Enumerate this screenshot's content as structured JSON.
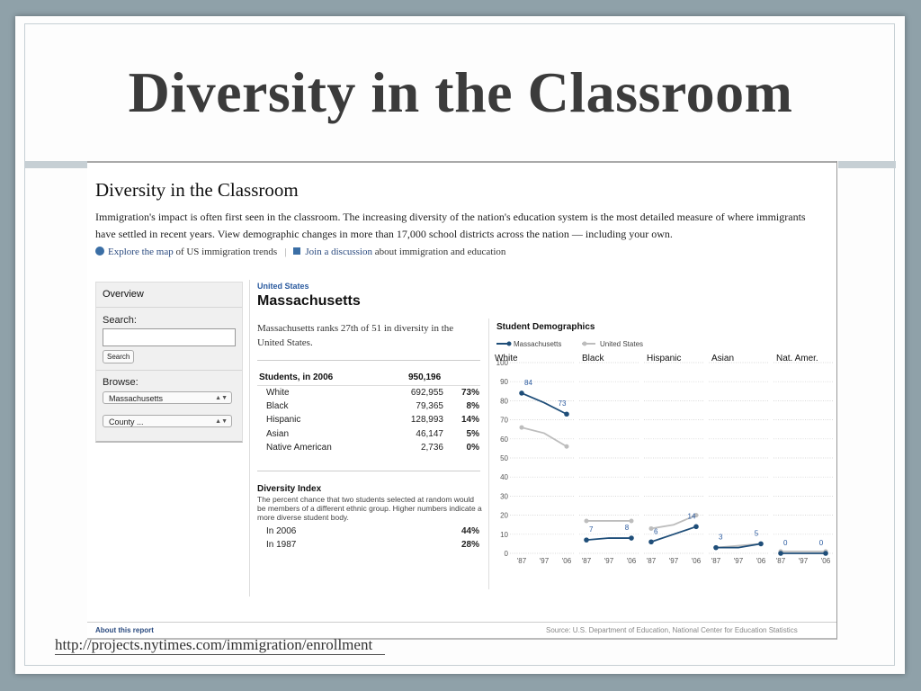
{
  "slide": {
    "title": "Diversity in the Classroom",
    "url": "http://projects.nytimes.com/immigration/enrollment"
  },
  "page": {
    "title": "Diversity in the Classroom",
    "intro": "Immigration's impact is often first seen in the classroom. The increasing diversity of the nation's education system is the most detailed measure of where immigrants have settled in recent years. View demographic changes in more than 17,000 school districts across the nation — including your own.",
    "link1": "Explore the map",
    "link1_rest": "of US immigration trends",
    "link2": "Join a discussion",
    "link2_rest": "about immigration and education",
    "footer_left": "About this report",
    "footer_right": "Source: U.S. Department of Education, National Center for Education Statistics"
  },
  "sidebar": {
    "overview": "Overview",
    "search_label": "Search:",
    "search_value": "",
    "search_button": "Search",
    "browse_label": "Browse:",
    "state_select": "Massachusetts",
    "county_select": "County ..."
  },
  "main": {
    "breadcrumb": "United States",
    "state": "Massachusetts",
    "rank_text": "Massachusetts ranks 27th of 51 in diversity in the United States.",
    "students_header": "Students, in 2006",
    "students_total": "950,196",
    "rows": [
      {
        "label": "White",
        "count": "692,955",
        "pct": "73%"
      },
      {
        "label": "Black",
        "count": "79,365",
        "pct": "8%"
      },
      {
        "label": "Hispanic",
        "count": "128,993",
        "pct": "14%"
      },
      {
        "label": "Asian",
        "count": "46,147",
        "pct": "5%"
      },
      {
        "label": "Native American",
        "count": "2,736",
        "pct": "0%"
      }
    ],
    "diversity_title": "Diversity Index",
    "diversity_desc": "The percent chance that two students selected at random would be members of a different ethnic group. Higher numbers indicate a more diverse student body.",
    "diversity_rows": [
      {
        "label": "In 2006",
        "value": "44%"
      },
      {
        "label": "In 1987",
        "value": "28%"
      }
    ]
  },
  "chart_data": {
    "type": "line",
    "title": "Student Demographics",
    "legend": [
      "Massachusetts",
      "United States"
    ],
    "colors": {
      "Massachusetts": "#1f4e79",
      "United States": "#bdbdbd"
    },
    "x": [
      "'87",
      "'97",
      "'06"
    ],
    "ylim": [
      0,
      100
    ],
    "yticks": [
      0,
      10,
      20,
      30,
      40,
      50,
      60,
      70,
      80,
      90,
      100
    ],
    "panels": [
      {
        "name": "White",
        "Massachusetts": [
          84,
          79,
          73
        ],
        "United States": [
          66,
          63,
          56
        ],
        "labels": {
          "start": "84",
          "end": "73"
        }
      },
      {
        "name": "Black",
        "Massachusetts": [
          7,
          8,
          8
        ],
        "United States": [
          17,
          17,
          17
        ],
        "labels": {
          "start": "7",
          "end": "8"
        }
      },
      {
        "name": "Hispanic",
        "Massachusetts": [
          6,
          10,
          14
        ],
        "United States": [
          13,
          15,
          20
        ],
        "labels": {
          "start": "6",
          "end": "14"
        }
      },
      {
        "name": "Asian",
        "Massachusetts": [
          3,
          3,
          5
        ],
        "United States": [
          3,
          4,
          5
        ],
        "labels": {
          "start": "3",
          "end": "5"
        }
      },
      {
        "name": "Nat. Amer.",
        "Massachusetts": [
          0,
          0,
          0
        ],
        "United States": [
          1,
          1,
          1
        ],
        "labels": {
          "start": "0",
          "end": "0"
        }
      }
    ]
  }
}
